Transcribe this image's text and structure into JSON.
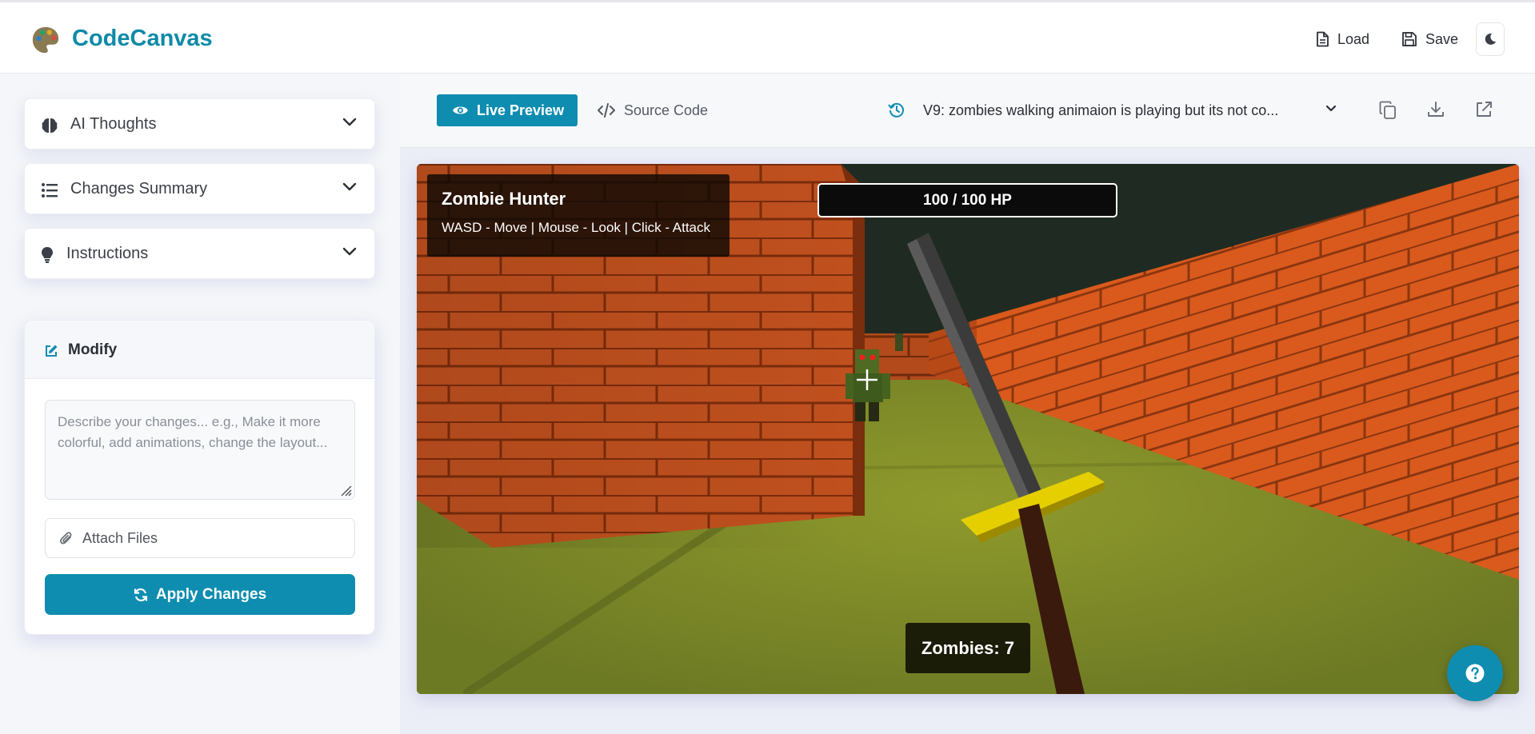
{
  "app": {
    "brand": "CodeCanvas",
    "load_label": "Load",
    "save_label": "Save"
  },
  "sidebar": {
    "accordions": [
      {
        "label": "AI Thoughts",
        "icon": "brain-icon"
      },
      {
        "label": "Changes Summary",
        "icon": "list-icon"
      },
      {
        "label": "Instructions",
        "icon": "lightbulb-icon"
      }
    ],
    "modify": {
      "title": "Modify",
      "placeholder": "Describe your changes... e.g., Make it more colorful, add animations, change the layout...",
      "attach_label": "Attach Files",
      "apply_label": "Apply Changes"
    }
  },
  "preview": {
    "live_tab": "Live Preview",
    "source_tab": "Source Code",
    "version": "V9: zombies walking animaion is playing but its not co..."
  },
  "game": {
    "title": "Zombie Hunter",
    "controls": "WASD - Move | Mouse - Look | Click - Attack",
    "hp": "100 / 100 HP",
    "zombies": "Zombies: 7"
  },
  "colors": {
    "accent": "#0e8db0",
    "brand": "#0e8aa8",
    "brick": "#c24e1b",
    "floor": "#7c8a2a"
  }
}
